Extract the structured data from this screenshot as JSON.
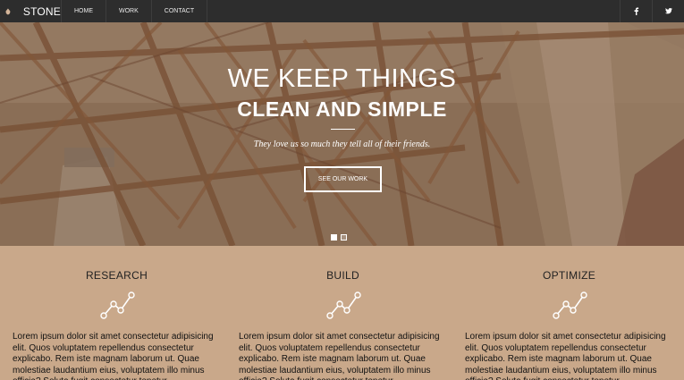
{
  "nav": {
    "brand": "STONE",
    "links": [
      "HOME",
      "WORK",
      "CONTACT"
    ],
    "social": [
      "facebook-icon",
      "twitter-icon"
    ]
  },
  "hero": {
    "title_line1": "WE KEEP THINGS",
    "title_line2": "CLEAN AND SIMPLE",
    "tagline": "They love us so much they tell all of their friends.",
    "cta_label": "SEE OUR WORK",
    "slide_count": 2,
    "active_slide": 1
  },
  "features": [
    {
      "title": "RESEARCH",
      "icon": "line-chart-icon",
      "text": "Lorem ipsum dolor sit amet consectetur adipisicing elit. Quos voluptatem repellendus consectetur explicabo. Rem iste magnam laborum ut. Quae molestiae laudantium eius, voluptatem illo minus officia? Soluta fugit consectetur tenetur."
    },
    {
      "title": "BUILD",
      "icon": "line-chart-icon",
      "text": "Lorem ipsum dolor sit amet consectetur adipisicing elit. Quos voluptatem repellendus consectetur explicabo. Rem iste magnam laborum ut. Quae molestiae laudantium eius, voluptatem illo minus officia? Soluta fugit consectetur tenetur."
    },
    {
      "title": "OPTIMIZE",
      "icon": "line-chart-icon",
      "text": "Lorem ipsum dolor sit amet consectetur adipisicing elit. Quos voluptatem repellendus consectetur explicabo. Rem iste magnam laborum ut. Quae molestiae laudantium eius, voluptatem illo minus officia? Soluta fugit consectetur tenetur."
    }
  ],
  "colors": {
    "nav_bg": "#2d2d2d",
    "hero_tint": "#8a6d55",
    "section_bg": "#c9a88a",
    "brand_icon": "#d4b59a"
  }
}
